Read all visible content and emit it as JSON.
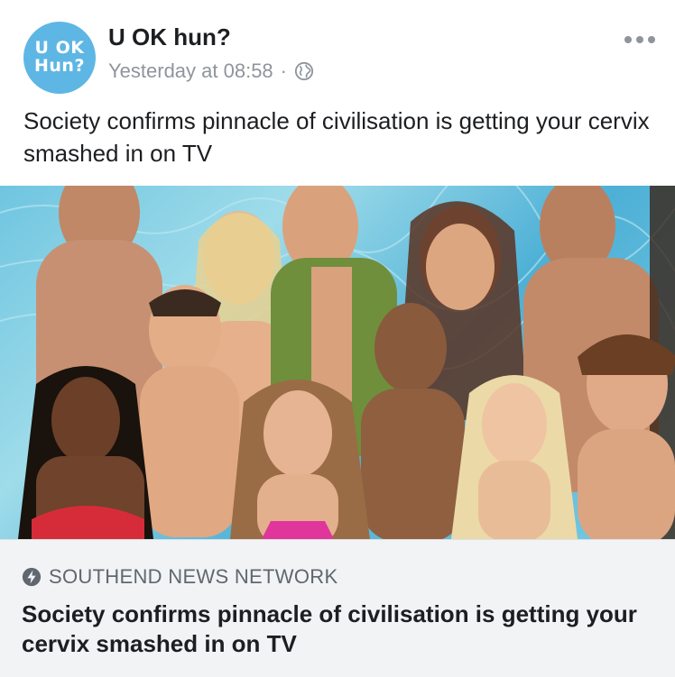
{
  "post": {
    "avatar": {
      "line1": "U OK",
      "line2": "Hun?"
    },
    "page_name": "U OK hun?",
    "timestamp": "Yesterday at 08:58",
    "separator": "·",
    "privacy_icon": "globe-icon",
    "more_icon": "more-options-icon",
    "caption": "Society confirms pinnacle of civilisation is getting your cervix smashed in on TV"
  },
  "link_preview": {
    "source_icon": "bolt-icon",
    "source": "SOUTHEND NEWS NETWORK",
    "title": "Society confirms pinnacle of civilisation is getting your cervix smashed in on TV"
  },
  "colors": {
    "avatar_bg": "#5eb6e4",
    "meta_text": "#90949c",
    "preview_bg": "#f2f3f5",
    "pool_water": "#6fc5e0"
  }
}
